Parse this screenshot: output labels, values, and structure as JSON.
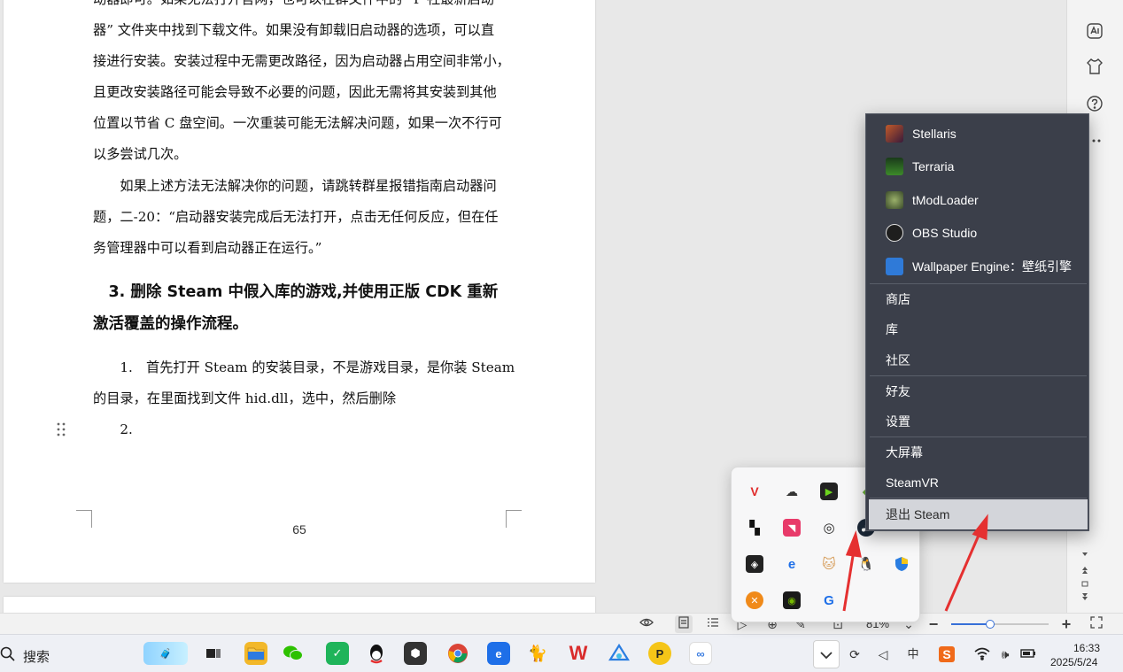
{
  "document": {
    "paragraphs": [
      "动器即可。如果无法打开官网，也可以在群文件中的 “P 社最新启动",
      "器” 文件夹中找到下载文件。如果没有卸载旧启动器的选项，可以直",
      "接进行安装。安装过程中无需更改路径，因为启动器占用空间非常小，",
      "且更改安装路径可能会导致不必要的问题，因此无需将其安装到其他",
      "位置以节省 C 盘空间。一次重装可能无法解决问题，如果一次不行可",
      "以多尝试几次。",
      "　　如果上述方法无法解决你的问题，请跳转群星报错指南启动器问",
      "题，二-20：“启动器安装完成后无法打开，点击无任何反应，但在任",
      "务管理器中可以看到启动器正在运行。”"
    ],
    "heading_line1": "　3. 删除 Steam 中假入库的游戏,并使用正版 CDK 重新",
    "heading_line2": "激活覆盖的操作流程。",
    "step1_line1": "　　1.　首先打开 Steam 的安装目录，不是游戏目录，是你装 Steam",
    "step1_line2": "的目录，在里面找到文件 hid.dll，选中，然后删除",
    "step2": "　　2.",
    "page_number": "65"
  },
  "status_bar": {
    "zoom": "81%",
    "zoom_fraction": 0.4,
    "zoom_minus": "−",
    "zoom_plus": "+"
  },
  "taskbar": {
    "search_label": "搜索",
    "time": "16:33",
    "date": "2025/5/24",
    "ime": "中"
  },
  "steam_menu": {
    "games": [
      {
        "label": "Stellaris",
        "icon": "stellaris-icon",
        "color": "#7a3b2e"
      },
      {
        "label": "Terraria",
        "icon": "terraria-icon",
        "color": "#2f6b2a"
      },
      {
        "label": "tModLoader",
        "icon": "tmodloader-icon",
        "color": "#5b6b3a"
      },
      {
        "label": "OBS Studio",
        "icon": "obs-icon",
        "color": "#2b2b2b"
      },
      {
        "label": "Wallpaper Engine：壁纸引擎",
        "icon": "wallpaper-engine-icon",
        "color": "#2f7ad8"
      }
    ],
    "nav": [
      "商店",
      "库",
      "社区"
    ],
    "social": [
      "好友",
      "设置"
    ],
    "modes": [
      "大屏幕",
      "SteamVR"
    ],
    "exit": "退出 Steam"
  },
  "colors": {
    "menu_bg": "#3b3f4a",
    "menu_highlight": "#d3d5da",
    "arrow": "#e53030",
    "accent": "#3770d8"
  }
}
